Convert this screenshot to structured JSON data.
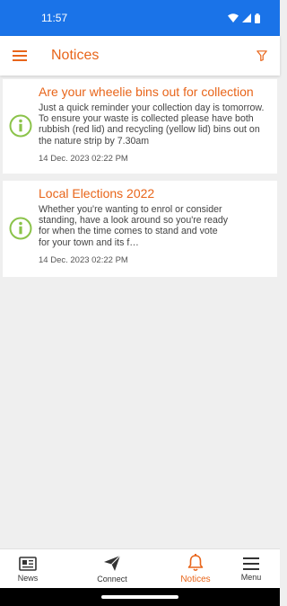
{
  "status_bar": {
    "time": "11:57"
  },
  "app_bar": {
    "title": "Notices"
  },
  "notices": [
    {
      "title": "Are your wheelie bins out for collection",
      "body": "Just a quick reminder your collection day is tomorrow.  To ensure your waste is collected please have both rubbish (red lid) and recycling (yellow lid) bins out on the nature strip by 7.30am",
      "date": "14 Dec. 2023 02:22 PM"
    },
    {
      "title": "Local Elections 2022",
      "body": "Whether you're wanting to enrol or consider standing, have a look around so you're ready for when the time comes to stand and vote for your town and its f…",
      "date": "14 Dec. 2023 02:22 PM"
    }
  ],
  "bottom_nav": {
    "items": [
      {
        "label": "News",
        "icon": "newspaper-icon"
      },
      {
        "label": "Connect",
        "icon": "send-icon"
      },
      {
        "label": "Notices",
        "icon": "bell-icon",
        "active": true
      },
      {
        "label": "Menu",
        "icon": "menu-icon"
      }
    ]
  },
  "colors": {
    "accent": "#e8651a",
    "status_bar": "#1a73e8",
    "info_icon": "#8bc34a"
  }
}
